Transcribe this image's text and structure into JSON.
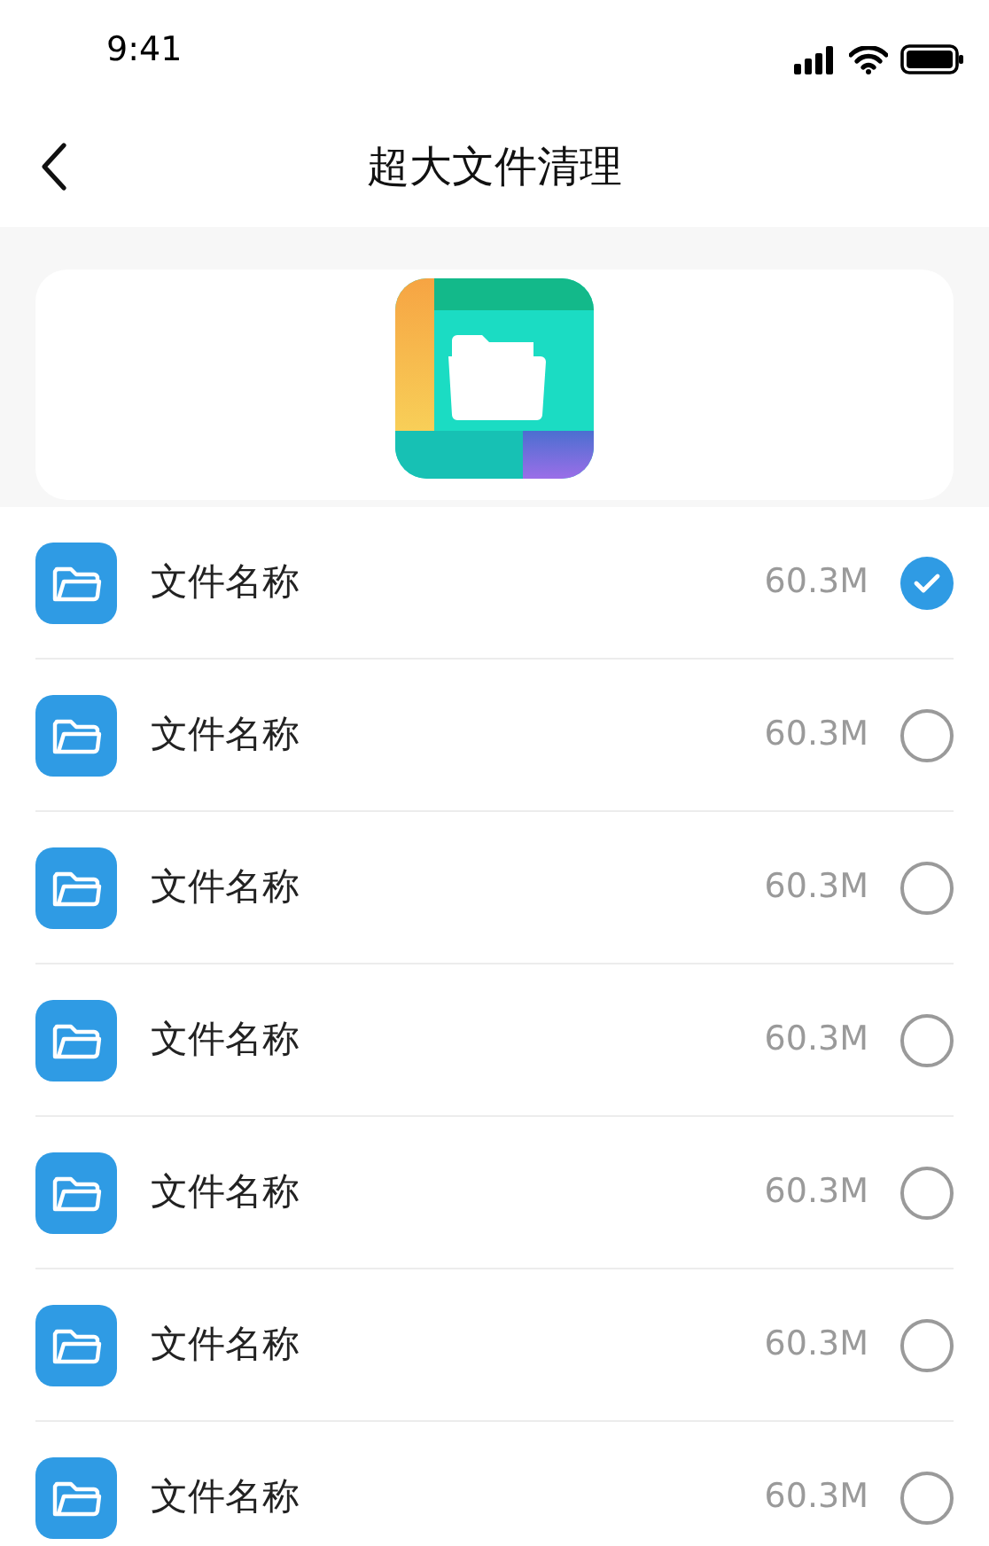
{
  "status_bar": {
    "time": "9:41"
  },
  "nav": {
    "title": "超大文件清理"
  },
  "files": [
    {
      "name": "文件名称",
      "size": "60.3M",
      "selected": true
    },
    {
      "name": "文件名称",
      "size": "60.3M",
      "selected": false
    },
    {
      "name": "文件名称",
      "size": "60.3M",
      "selected": false
    },
    {
      "name": "文件名称",
      "size": "60.3M",
      "selected": false
    },
    {
      "name": "文件名称",
      "size": "60.3M",
      "selected": false
    },
    {
      "name": "文件名称",
      "size": "60.3M",
      "selected": false
    },
    {
      "name": "文件名称",
      "size": "60.3M",
      "selected": false
    }
  ]
}
